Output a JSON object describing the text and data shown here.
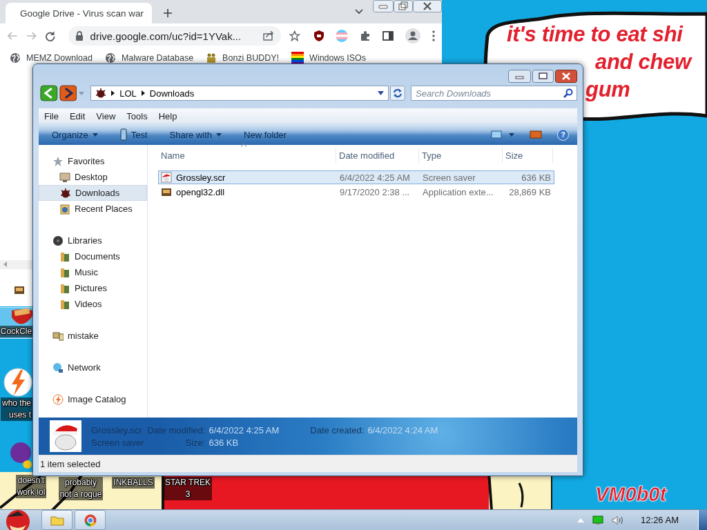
{
  "desktop": {
    "wallpaper_text": [
      "it's time to eat shi",
      "and chew",
      "gum"
    ],
    "signature": "VM0b0t",
    "icons": [
      {
        "kind": "cleaner",
        "label": [
          "CockCle"
        ],
        "selected": true
      },
      {
        "kind": "bolt",
        "label": [
          "who the",
          "uses t"
        ],
        "selected": false
      },
      {
        "kind": "yahoo",
        "label": [
          "doesn't",
          "work lol"
        ],
        "selected": false
      },
      {
        "kind": "hidden",
        "label": [
          "probably",
          "not a rogue"
        ],
        "selected": false
      },
      {
        "kind": "hidden",
        "label": [
          "INKBALLS"
        ],
        "selected": false
      },
      {
        "kind": "hidden",
        "label": [
          "STAR TREK",
          "3"
        ],
        "selected": false
      }
    ]
  },
  "chrome": {
    "tab_title": "Google Drive - Virus scan war",
    "url": "drive.google.com/uc?id=1YVak...",
    "bookmarks": [
      {
        "label": "MEMZ Download",
        "kind": "globe"
      },
      {
        "label": "Malware Database",
        "kind": "globe"
      },
      {
        "label": "Bonzi BUDDY!",
        "kind": "figure"
      },
      {
        "label": "Windows ISOs",
        "kind": "flag"
      }
    ]
  },
  "explorer": {
    "breadcrumb": [
      "LOL",
      "Downloads"
    ],
    "search": {
      "placeholder": "Search Downloads"
    },
    "menu": [
      "File",
      "Edit",
      "View",
      "Tools",
      "Help"
    ],
    "commands": [
      {
        "label": "Organize",
        "kind": "dropdown"
      },
      {
        "label": "Test",
        "kind": "icon"
      },
      {
        "label": "Share with",
        "kind": "dropdown"
      },
      {
        "label": "New folder",
        "kind": "plain"
      }
    ],
    "help": "?",
    "navigation": [
      {
        "label": "Favorites",
        "kind": "star",
        "selected": false,
        "items": [
          {
            "label": "Desktop",
            "kind": "desktop",
            "selected": false
          },
          {
            "label": "Downloads",
            "kind": "splat",
            "selected": true
          },
          {
            "label": "Recent Places",
            "kind": "recent",
            "selected": false
          }
        ]
      },
      {
        "label": "Libraries",
        "kind": "disc",
        "selected": false,
        "items": [
          {
            "label": "Documents",
            "kind": "library",
            "selected": false
          },
          {
            "label": "Music",
            "kind": "library",
            "selected": false
          },
          {
            "label": "Pictures",
            "kind": "library",
            "selected": false
          },
          {
            "label": "Videos",
            "kind": "library",
            "selected": false
          }
        ]
      },
      {
        "label": "mistake",
        "kind": "computer",
        "selected": false
      },
      {
        "label": "Network",
        "kind": "network",
        "selected": false
      },
      {
        "label": "Image Catalog",
        "kind": "bolt",
        "selected": false
      }
    ],
    "columns": [
      "Name",
      "Date modified",
      "Type",
      "Size"
    ],
    "files": [
      {
        "name": "Grossley.scr",
        "date_modified": "6/4/2022 4:25 AM",
        "type": "Screen saver",
        "size": "636 KB",
        "kind": "screensaver",
        "selected": true
      },
      {
        "name": "opengl32.dll",
        "date_modified": "9/17/2020 2:38 ...",
        "type": "Application exte...",
        "size": "28,869 KB",
        "kind": "dll",
        "selected": false
      }
    ],
    "details": {
      "name": "Grossley.scr",
      "type": "Screen saver",
      "properties": [
        {
          "label": "Date modified:",
          "value": "6/4/2022 4:25 AM"
        },
        {
          "label": "Size:",
          "value": "636 KB"
        },
        {
          "label": "Date created:",
          "value": "6/4/2022 4:24 AM"
        }
      ]
    },
    "status": "1 item selected"
  },
  "taskbar": {
    "clock": "12:26 AM"
  }
}
